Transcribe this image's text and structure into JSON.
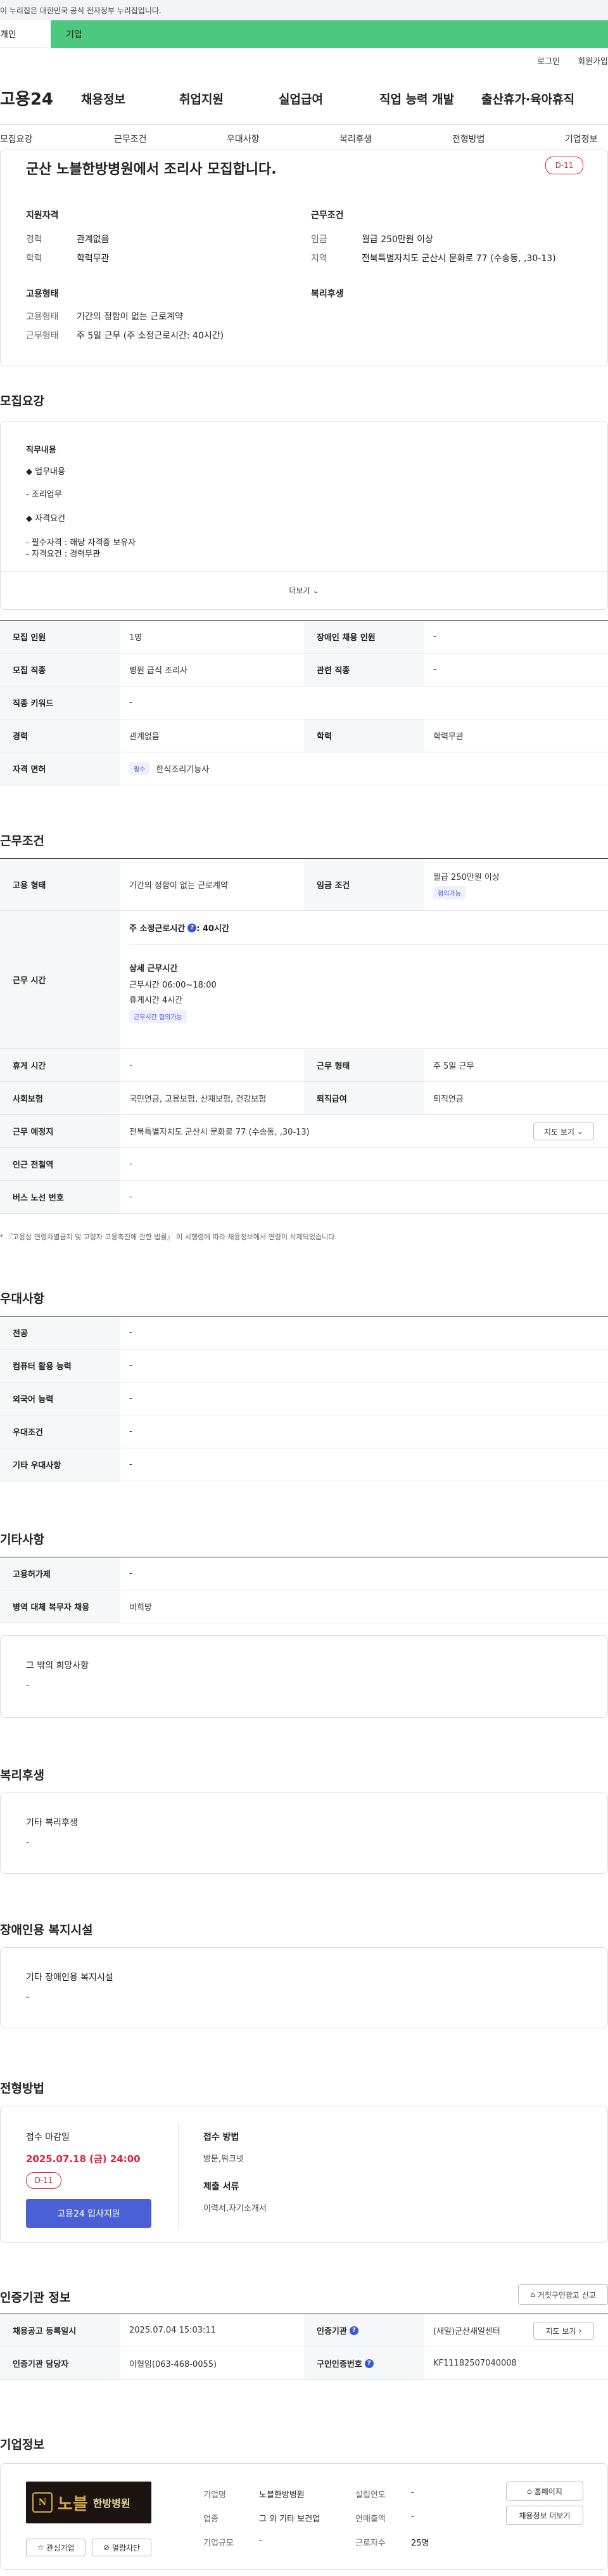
{
  "gov_banner": "이 누리집은 대한민국 공식 전자정부 누리집입니다.",
  "top_tabs": {
    "personal": "개인",
    "company": "기업"
  },
  "util": {
    "login": "로그인",
    "join": "회원가입"
  },
  "logo": "고용24",
  "gnb": [
    "채용정보",
    "취업지원",
    "실업급여",
    "직업 능력 개발",
    "출산휴가·육아휴직"
  ],
  "subnav": [
    "모집요강",
    "근무조건",
    "우대사항",
    "복리후생",
    "전형방법",
    "기업정보"
  ],
  "summary": {
    "title": "군산 노블한방병원에서 조리사 모집합니다.",
    "dday": "D-11",
    "qual_title": "지원자격",
    "cond_title": "근무조건",
    "career_label": "경력",
    "career": "관계없음",
    "edu_label": "학력",
    "edu": "학력무관",
    "wage_label": "임금",
    "wage": "월급 250만원 이상",
    "region_label": "지역",
    "region": "전북특별자치도 군산시 문화로 77 (수송동, ,30-13)",
    "emp_title": "고용형태",
    "welfare_title": "복리후생",
    "emp_type_label": "고용형태",
    "emp_type": "기간의 정함이 없는 근로계약",
    "work_label": "근무형태",
    "work": "주 5일 근무 (주 소정근로시간: 40시간)"
  },
  "recruit": {
    "heading": "모집요강",
    "duty_title": "직무내용",
    "line1": "◆ 업무내용",
    "line2": "- 조리업무",
    "line3": "◆ 자격요건",
    "line4": "- 필수자격 : 해당 자격증 보유자",
    "line5": "- 자격요건 : 경력무관",
    "more": "더보기",
    "rows": {
      "headcount_label": "모집 인원",
      "headcount": "1명",
      "disabled_label": "장애인 채용 인원",
      "disabled": "-",
      "job_label": "모집 직종",
      "job": "병원 급식 조리사",
      "related_label": "관련 직종",
      "related": "-",
      "keyword_label": "직종 키워드",
      "keyword": "-",
      "career_label": "경력",
      "career": "관계없음",
      "edu_label": "학력",
      "edu": "학력무관",
      "license_label": "자격 면허",
      "license_tag": "필수",
      "license": "한식조리기능사"
    }
  },
  "conditions": {
    "heading": "근무조건",
    "emp_label": "고용 형태",
    "emp": "기간의 정함이 없는 근로계약",
    "wage_label": "임금 조건",
    "wage": "월급 250만원 이상",
    "wage_tag": "협의가능",
    "time_label": "근무 시간",
    "weekly": "주 소정근로시간",
    "weekly_val": ": 40시간",
    "detail_title": "상세 근무시간",
    "hours": "근무시간 06:00~18:00",
    "rest": "휴게시간 4시간",
    "hours_tag": "근무시간 협의가능",
    "break_label": "휴게 시간",
    "break": "-",
    "form_label": "근무 형태",
    "form": "주 5일 근무",
    "insurance_label": "사회보험",
    "insurance": "국민연금, 고용보험, 산재보험, 건강보험",
    "retire_label": "퇴직급여",
    "retire": "퇴직연금",
    "place_label": "근무 예정지",
    "place": "전북특별자치도 군산시 문화로 77 (수송동, ,30-13)",
    "map_btn": "지도 보기",
    "subway_label": "인근 전철역",
    "subway": "-",
    "bus_label": "버스 노선 번호",
    "bus": "-",
    "note": "* 『고용상 연령차별금지 및 고령자 고용촉진에 관한 법률』 이 시행령에 따라 채용정보에서 연령이 삭제되었습니다."
  },
  "prefer": {
    "heading": "우대사항",
    "major_label": "전공",
    "major": "-",
    "computer_label": "컴퓨터 활용 능력",
    "computer": "-",
    "lang_label": "외국어 능력",
    "lang": "-",
    "cond_label": "우대조건",
    "cond": "-",
    "etc_label": "기타 우대사항",
    "etc": "-"
  },
  "etc": {
    "heading": "기타사항",
    "permit_label": "고용허가제",
    "permit": "-",
    "military_label": "병역 대체 복무자 채용",
    "military": "비희망",
    "wish_title": "그 밖의 희망사항",
    "wish": "-"
  },
  "welfare": {
    "heading": "복리후생",
    "title": "기타 복리후생",
    "value": "-"
  },
  "facility": {
    "heading": "장애인용 복지시설",
    "title": "기타 장애인용 복지시설",
    "value": "-"
  },
  "process": {
    "heading": "전형방법",
    "deadline_title": "접수 마감일",
    "deadline": "2025.07.18 (금) 24:00",
    "dday": "D-11",
    "apply_btn": "고용24 입사지원",
    "method_title": "접수 방법",
    "method": "방문,워크넷",
    "docs_title": "제출 서류",
    "docs": "이력서,자기소개서"
  },
  "agency": {
    "heading": "인증기관 정보",
    "report_btn": "거짓구인광고 신고",
    "reg_label": "채용공고 등록일시",
    "reg": "2025.07.04 15:03:11",
    "agency_label": "인증기관",
    "agency": "(새일)군산새일센터",
    "map_btn": "지도 보기",
    "contact_label": "인증기관 담당자",
    "contact": "이형임(063-468-0055)",
    "no_label": "구인인증번호",
    "no": "KF11182507040008"
  },
  "company": {
    "heading": "기업정보",
    "logo_main": "노블",
    "logo_sub": "한방병원",
    "fav_btn": "관심기업",
    "block_btn": "열람차단",
    "name_label": "기업명",
    "name": "노블한방병원",
    "industry_label": "업종",
    "industry": "그 외 기타 보건업",
    "size_label": "기업규모",
    "size": "-",
    "founded_label": "설립연도",
    "founded": "-",
    "sales_label": "연매출액",
    "sales": "-",
    "workers_label": "근로자수",
    "workers": "25명",
    "home_btn": "홈페이지",
    "jobs_btn": "채용정보 더보기"
  }
}
